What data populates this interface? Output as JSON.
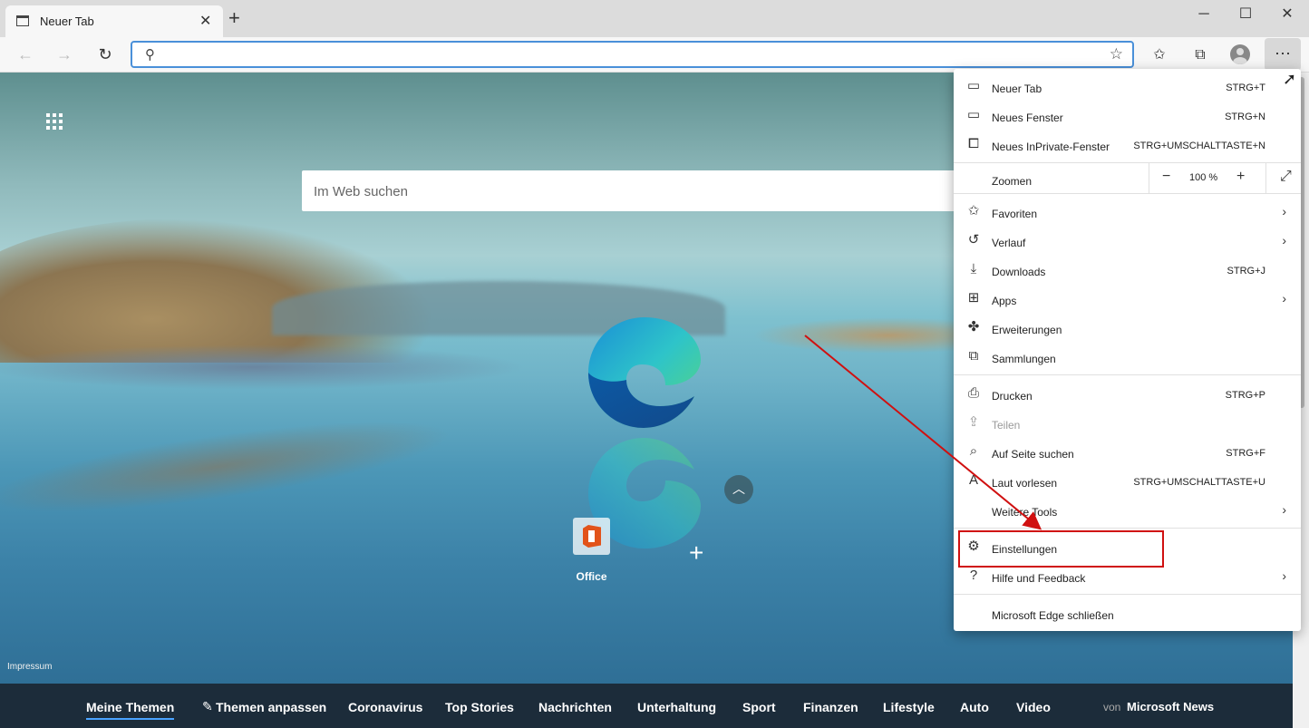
{
  "browser": {
    "tab_title": "Neuer Tab",
    "window_controls": {
      "minimize": "─",
      "maximize": "☐",
      "close": "✕"
    }
  },
  "page": {
    "websearch_placeholder": "Im Web suchen",
    "quicklink": {
      "label": "Office"
    },
    "impressum": "Impressum"
  },
  "menu": {
    "items": [
      {
        "label": "Neuer Tab",
        "shortcut": "STRG+T",
        "icon": "tab-icon"
      },
      {
        "label": "Neues Fenster",
        "shortcut": "STRG+N",
        "icon": "window-icon"
      },
      {
        "label": "Neues InPrivate-Fenster",
        "shortcut": "STRG+UMSCHALTTASTE+N",
        "icon": "inprivate-icon"
      }
    ],
    "zoom": {
      "label": "Zoomen",
      "minus": "−",
      "value": "100 %",
      "plus": "+"
    },
    "items2": [
      {
        "label": "Favoriten",
        "icon": "favorites-icon"
      },
      {
        "label": "Verlauf",
        "icon": "history-icon"
      },
      {
        "label": "Downloads",
        "shortcut": "STRG+J",
        "icon": "download-icon"
      },
      {
        "label": "Apps",
        "icon": "apps-icon"
      },
      {
        "label": "Erweiterungen",
        "icon": "extensions-icon"
      },
      {
        "label": "Sammlungen",
        "icon": "collections-icon"
      }
    ],
    "items3": [
      {
        "label": "Drucken",
        "shortcut": "STRG+P",
        "icon": "print-icon"
      },
      {
        "label": "Teilen",
        "icon": "share-icon"
      },
      {
        "label": "Auf Seite suchen",
        "shortcut": "STRG+F",
        "icon": "find-icon"
      },
      {
        "label": "Laut vorlesen",
        "shortcut": "STRG+UMSCHALTTASTE+U",
        "icon": "read-aloud-icon"
      },
      {
        "label": "Weitere Tools"
      }
    ],
    "items4": [
      {
        "label": "Einstellungen",
        "icon": "gear-icon"
      },
      {
        "label": "Hilfe und Feedback",
        "icon": "help-icon"
      }
    ],
    "close": {
      "label": "Microsoft Edge schließen"
    }
  },
  "newsbar": {
    "items": [
      "Meine Themen",
      "Themen anpassen",
      "Coronavirus",
      "Top Stories",
      "Nachrichten",
      "Unterhaltung",
      "Sport",
      "Finanzen",
      "Lifestyle",
      "Auto",
      "Video"
    ],
    "von": "von",
    "brand": "Microsoft News"
  },
  "colors": {
    "highlight": "#d01010",
    "accent": "#4aa3ff"
  }
}
